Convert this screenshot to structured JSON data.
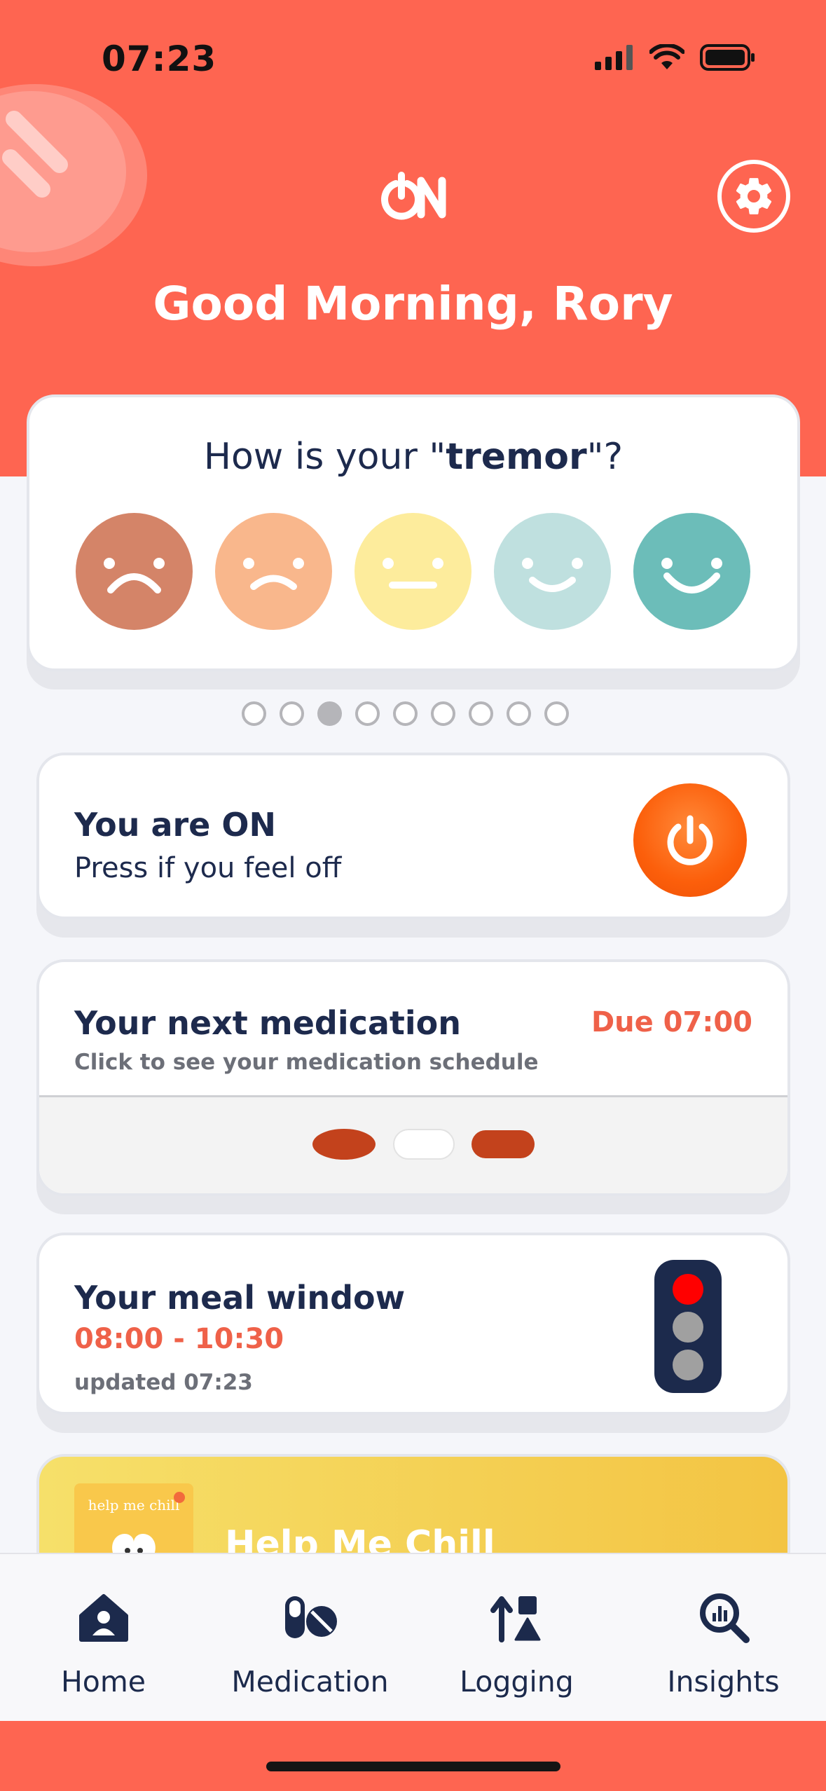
{
  "status_bar": {
    "time": "07:23"
  },
  "header": {
    "logo_text": "ON",
    "greeting": "Good Morning, Rory"
  },
  "mood": {
    "question_prefix": "How is your \"",
    "question_keyword": "tremor",
    "question_suffix": "\"?",
    "faces": [
      {
        "name": "very-bad",
        "color": "#d48468"
      },
      {
        "name": "bad",
        "color": "#f9b78c"
      },
      {
        "name": "neutral",
        "color": "#fdec9c"
      },
      {
        "name": "good",
        "color": "#bfe0df"
      },
      {
        "name": "very-good",
        "color": "#6cbdb9"
      }
    ],
    "page_count": 9,
    "active_page": 3
  },
  "on_status": {
    "title": "You are ON",
    "subtitle": "Press if you feel off"
  },
  "medication": {
    "title": "Your next medication",
    "due": "Due 07:00",
    "subtitle": "Click to see your medication schedule",
    "pill_colors": [
      "#c3421c",
      "#ffffff",
      "#c3421c"
    ]
  },
  "meal": {
    "title": "Your meal window",
    "window": "08:00 - 10:30",
    "updated": "updated 07:23",
    "traffic_light": {
      "red": "#ff0000",
      "amber_off": "#a0a0a0",
      "green_off": "#a0a0a0"
    }
  },
  "chill": {
    "title": "Help Me Chill",
    "thumb_text": "help me chill"
  },
  "tabs": [
    {
      "label": "Home",
      "icon": "home-icon"
    },
    {
      "label": "Medication",
      "icon": "pills-icon"
    },
    {
      "label": "Logging",
      "icon": "logging-icon"
    },
    {
      "label": "Insights",
      "icon": "insights-icon"
    }
  ],
  "colors": {
    "brand": "#fe6551",
    "navy": "#1c2a4c",
    "accent_orange": "#fc5f0b"
  }
}
